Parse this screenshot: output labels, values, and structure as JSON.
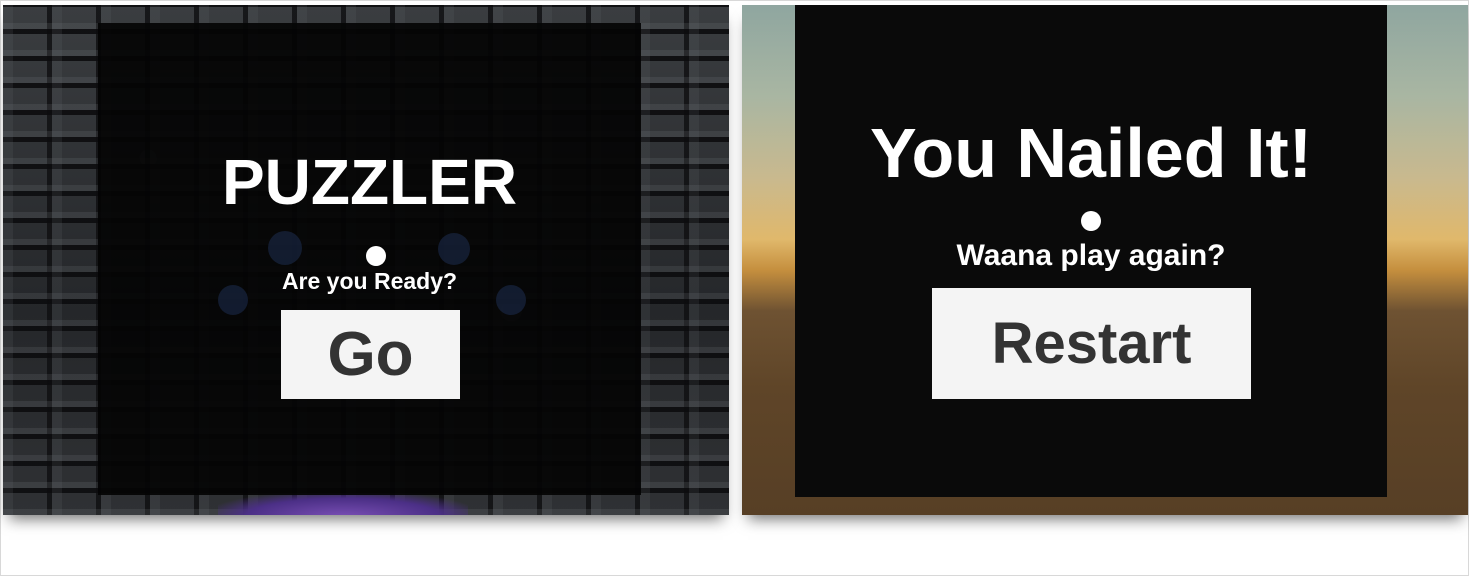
{
  "start_screen": {
    "title": "PUZZLER",
    "prompt": "Are you Ready?",
    "button_label": "Go"
  },
  "end_screen": {
    "title": "You Nailed It!",
    "prompt": "Waana play again?",
    "button_label": "Restart"
  },
  "colors": {
    "menu_background": "#0a0a0a",
    "text": "#ffffff",
    "button_background": "#f4f4f4",
    "button_text": "#333333",
    "accent_glow": "#7a4fb5"
  }
}
